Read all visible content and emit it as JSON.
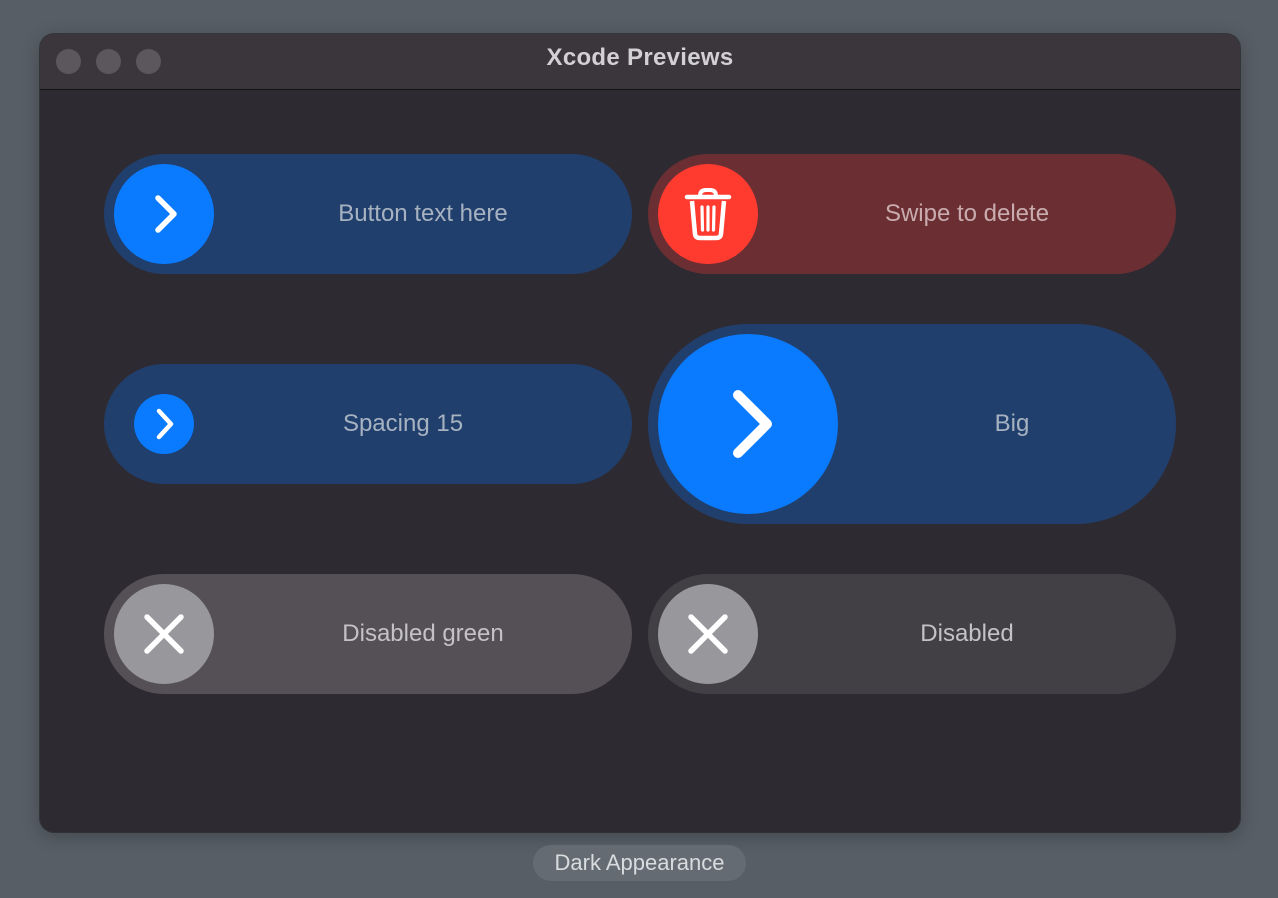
{
  "window": {
    "title": "Xcode Previews"
  },
  "buttons": [
    {
      "label": "Button text here",
      "icon": "chevron-right-icon",
      "state": "enabled",
      "color": "#0a7aff"
    },
    {
      "label": "Swipe to delete",
      "icon": "trash-icon",
      "state": "enabled",
      "color": "#ff3b30"
    },
    {
      "label": "Spacing 15",
      "icon": "chevron-right-icon",
      "state": "enabled",
      "color": "#0a7aff"
    },
    {
      "label": "Big",
      "icon": "chevron-right-icon",
      "state": "enabled",
      "color": "#0a7aff"
    },
    {
      "label": "Disabled green",
      "icon": "xmark-icon",
      "state": "disabled",
      "color": "#98979b"
    },
    {
      "label": "Disabled",
      "icon": "xmark-icon",
      "state": "disabled",
      "color": "#98979b"
    }
  ],
  "footer": {
    "appearance_label": "Dark Appearance"
  }
}
